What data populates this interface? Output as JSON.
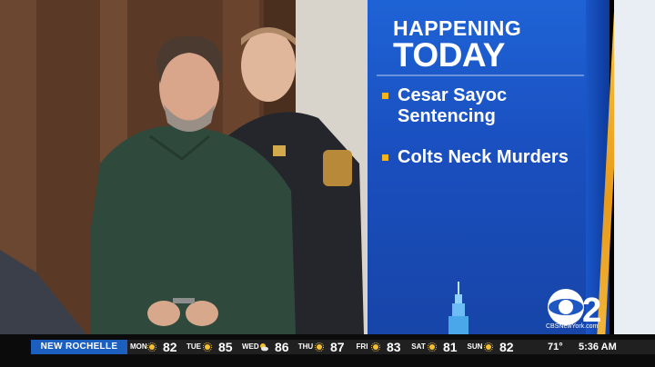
{
  "graphic": {
    "header_line1": "HAPPENING",
    "header_line2": "TODAY",
    "items": [
      {
        "label": "Cesar Sayoc Sentencing"
      },
      {
        "label": "Colts Neck Murders"
      }
    ],
    "logo_caption": "CBSNewYork.com",
    "logo_icon": "cbs-2-eye-icon",
    "colors": {
      "panel_blue": "#1e63d6",
      "accent_gold": "#f2b51c"
    }
  },
  "ticker": {
    "city": "NEW ROCHELLE",
    "forecast": [
      {
        "day": "MON",
        "icon": "sun-icon",
        "temp": "82"
      },
      {
        "day": "TUE",
        "icon": "sun-icon",
        "temp": "85"
      },
      {
        "day": "WED",
        "icon": "partly-cloudy-icon",
        "temp": "86"
      },
      {
        "day": "THU",
        "icon": "sun-icon",
        "temp": "87"
      },
      {
        "day": "FRI",
        "icon": "sun-icon",
        "temp": "83"
      },
      {
        "day": "SAT",
        "icon": "sun-icon",
        "temp": "81"
      },
      {
        "day": "SUN",
        "icon": "sun-icon",
        "temp": "82"
      }
    ],
    "current_temp": "71°",
    "time": "5:36 AM"
  }
}
